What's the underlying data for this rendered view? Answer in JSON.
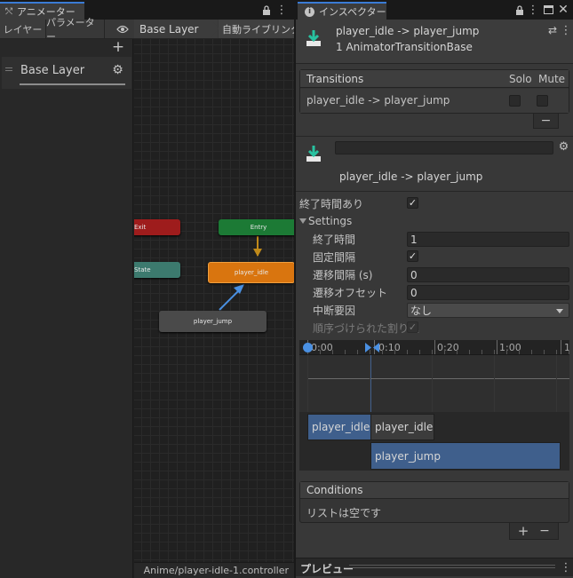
{
  "animator": {
    "tab_title": "アニメーター",
    "layers_tab": "レイヤー",
    "params_tab": "パラメーター",
    "breadcrumb": "Base Layer",
    "auto_live_link": "自動ライブリンク",
    "layer_name": "Base Layer",
    "nodes": {
      "exit": "Exit",
      "entry": "Entry",
      "state": "State",
      "player_idle": "player_idle",
      "player_jump": "player_jump"
    },
    "footer_path": "Anime/player-idle-1.controller"
  },
  "inspector": {
    "tab_title": "インスペクター",
    "header": {
      "title": "player_idle -> player_jump",
      "subtitle": "1 AnimatorTransitionBase"
    },
    "transitions": {
      "heading": "Transitions",
      "solo_label": "Solo",
      "mute_label": "Mute",
      "row_label": "player_idle -> player_jump",
      "solo_checked": false,
      "mute_checked": false
    },
    "transition_name": "player_idle -> player_jump",
    "has_exit_time_label": "終了時間あり",
    "has_exit_time": true,
    "settings": {
      "heading": "Settings",
      "exit_time_label": "終了時間",
      "exit_time_value": "1",
      "fixed_duration_label": "固定間隔",
      "fixed_duration": true,
      "duration_label": "遷移間隔 (s)",
      "duration_value": "0",
      "offset_label": "遷移オフセット",
      "offset_value": "0",
      "interruption_label": "中断要因",
      "interruption_value": "なし",
      "ordered_label": "順序づけられた割り込",
      "ordered": true
    },
    "timeline": {
      "ticks": [
        "0:00",
        "0:10",
        "0:20",
        "1:00",
        "1"
      ],
      "clip_idle_a": "player_idle",
      "clip_idle_b": "player_idle",
      "clip_jump": "player_jump"
    },
    "conditions": {
      "heading": "Conditions",
      "empty_text": "リストは空です"
    },
    "preview_label": "プレビュー",
    "colors": {
      "accent": "#3a7bd5",
      "idle_node": "#d9750f",
      "entry_node": "#1c7a35",
      "exit_node": "#9e1c1c",
      "state_node": "#3c7a6e",
      "jump_clip": "#3f5f8c"
    }
  }
}
